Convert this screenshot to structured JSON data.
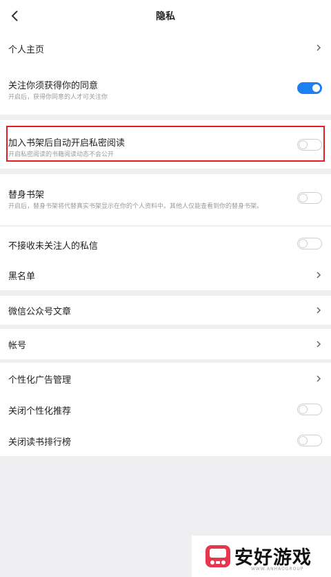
{
  "header": {
    "title": "隐私"
  },
  "items": [
    {
      "label": "个人主页"
    },
    {
      "label": "关注你须获得你的同意",
      "sub": "开启后，获得你同意的人才可关注你",
      "on": true
    },
    {
      "label": "加入书架后自动开启私密阅读",
      "sub": "开启私密阅读的书籍阅读动态不会公开",
      "on": false
    },
    {
      "label": "替身书架",
      "sub": "开启后，替身书架将代替真实书架显示在你的个人资料中。其他人仅能查看到你的替身书架。",
      "on": false
    },
    {
      "label": "不接收未关注人的私信",
      "on": false
    },
    {
      "label": "黑名单"
    },
    {
      "label": "微信公众号文章"
    },
    {
      "label": "帐号"
    },
    {
      "label": "个性化广告管理"
    },
    {
      "label": "关闭个性化推荐",
      "on": false
    },
    {
      "label": "关闭读书排行榜",
      "on": false
    }
  ],
  "watermark": {
    "text": "安好游戏",
    "url": "WWW.ANHAOGROUP"
  },
  "colors": {
    "accent": "#1e7ff0",
    "highlight": "#e02020"
  }
}
